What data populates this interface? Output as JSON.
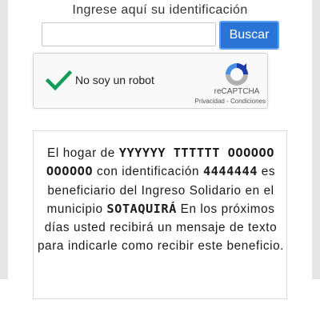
{
  "form": {
    "prompt": "Ingrese aquí su identificación",
    "id_value": "",
    "search_label": "Buscar"
  },
  "recaptcha": {
    "checked": true,
    "label": "No soy un robot",
    "brand": "reCAPTCHA",
    "links": "Privacidad - Condiciones",
    "check_icon": "check-icon",
    "logo_icon": "recaptcha-logo-icon",
    "colors": {
      "check": "#0f9d58",
      "logo_blue": "#1c3aa9",
      "logo_light": "#4a90e2",
      "logo_gray": "#b0b0b0"
    }
  },
  "result": {
    "line1_pre": "El hogar de ",
    "household_name": "YYYYYY TTTTTT OOOOOO OOOOOO",
    "line2_pre": " con identificación ",
    "identification": "4444444",
    "line3": " es beneficiario del Ingreso Solidario en el municipio ",
    "municipality": "SOTAQUIRÁ",
    "line4": " En los próximos días usted recibirá un mensaje de texto para indicarle como recibir este beneficio."
  },
  "colors": {
    "button": "#2a74d6",
    "button_border": "#5aa0f0"
  }
}
